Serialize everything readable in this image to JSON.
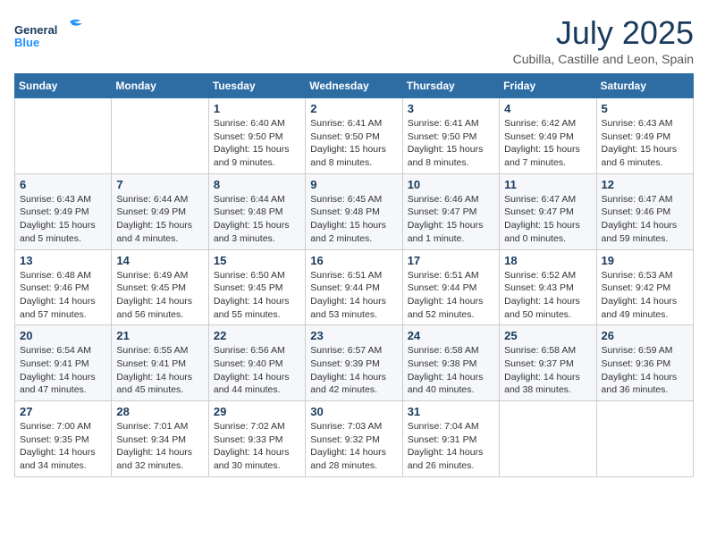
{
  "logo": {
    "line1": "General",
    "line2": "Blue"
  },
  "title": "July 2025",
  "location": "Cubilla, Castille and Leon, Spain",
  "weekdays": [
    "Sunday",
    "Monday",
    "Tuesday",
    "Wednesday",
    "Thursday",
    "Friday",
    "Saturday"
  ],
  "weeks": [
    [
      {
        "day": "",
        "info": ""
      },
      {
        "day": "",
        "info": ""
      },
      {
        "day": "1",
        "info": "Sunrise: 6:40 AM\nSunset: 9:50 PM\nDaylight: 15 hours and 9 minutes."
      },
      {
        "day": "2",
        "info": "Sunrise: 6:41 AM\nSunset: 9:50 PM\nDaylight: 15 hours and 8 minutes."
      },
      {
        "day": "3",
        "info": "Sunrise: 6:41 AM\nSunset: 9:50 PM\nDaylight: 15 hours and 8 minutes."
      },
      {
        "day": "4",
        "info": "Sunrise: 6:42 AM\nSunset: 9:49 PM\nDaylight: 15 hours and 7 minutes."
      },
      {
        "day": "5",
        "info": "Sunrise: 6:43 AM\nSunset: 9:49 PM\nDaylight: 15 hours and 6 minutes."
      }
    ],
    [
      {
        "day": "6",
        "info": "Sunrise: 6:43 AM\nSunset: 9:49 PM\nDaylight: 15 hours and 5 minutes."
      },
      {
        "day": "7",
        "info": "Sunrise: 6:44 AM\nSunset: 9:49 PM\nDaylight: 15 hours and 4 minutes."
      },
      {
        "day": "8",
        "info": "Sunrise: 6:44 AM\nSunset: 9:48 PM\nDaylight: 15 hours and 3 minutes."
      },
      {
        "day": "9",
        "info": "Sunrise: 6:45 AM\nSunset: 9:48 PM\nDaylight: 15 hours and 2 minutes."
      },
      {
        "day": "10",
        "info": "Sunrise: 6:46 AM\nSunset: 9:47 PM\nDaylight: 15 hours and 1 minute."
      },
      {
        "day": "11",
        "info": "Sunrise: 6:47 AM\nSunset: 9:47 PM\nDaylight: 15 hours and 0 minutes."
      },
      {
        "day": "12",
        "info": "Sunrise: 6:47 AM\nSunset: 9:46 PM\nDaylight: 14 hours and 59 minutes."
      }
    ],
    [
      {
        "day": "13",
        "info": "Sunrise: 6:48 AM\nSunset: 9:46 PM\nDaylight: 14 hours and 57 minutes."
      },
      {
        "day": "14",
        "info": "Sunrise: 6:49 AM\nSunset: 9:45 PM\nDaylight: 14 hours and 56 minutes."
      },
      {
        "day": "15",
        "info": "Sunrise: 6:50 AM\nSunset: 9:45 PM\nDaylight: 14 hours and 55 minutes."
      },
      {
        "day": "16",
        "info": "Sunrise: 6:51 AM\nSunset: 9:44 PM\nDaylight: 14 hours and 53 minutes."
      },
      {
        "day": "17",
        "info": "Sunrise: 6:51 AM\nSunset: 9:44 PM\nDaylight: 14 hours and 52 minutes."
      },
      {
        "day": "18",
        "info": "Sunrise: 6:52 AM\nSunset: 9:43 PM\nDaylight: 14 hours and 50 minutes."
      },
      {
        "day": "19",
        "info": "Sunrise: 6:53 AM\nSunset: 9:42 PM\nDaylight: 14 hours and 49 minutes."
      }
    ],
    [
      {
        "day": "20",
        "info": "Sunrise: 6:54 AM\nSunset: 9:41 PM\nDaylight: 14 hours and 47 minutes."
      },
      {
        "day": "21",
        "info": "Sunrise: 6:55 AM\nSunset: 9:41 PM\nDaylight: 14 hours and 45 minutes."
      },
      {
        "day": "22",
        "info": "Sunrise: 6:56 AM\nSunset: 9:40 PM\nDaylight: 14 hours and 44 minutes."
      },
      {
        "day": "23",
        "info": "Sunrise: 6:57 AM\nSunset: 9:39 PM\nDaylight: 14 hours and 42 minutes."
      },
      {
        "day": "24",
        "info": "Sunrise: 6:58 AM\nSunset: 9:38 PM\nDaylight: 14 hours and 40 minutes."
      },
      {
        "day": "25",
        "info": "Sunrise: 6:58 AM\nSunset: 9:37 PM\nDaylight: 14 hours and 38 minutes."
      },
      {
        "day": "26",
        "info": "Sunrise: 6:59 AM\nSunset: 9:36 PM\nDaylight: 14 hours and 36 minutes."
      }
    ],
    [
      {
        "day": "27",
        "info": "Sunrise: 7:00 AM\nSunset: 9:35 PM\nDaylight: 14 hours and 34 minutes."
      },
      {
        "day": "28",
        "info": "Sunrise: 7:01 AM\nSunset: 9:34 PM\nDaylight: 14 hours and 32 minutes."
      },
      {
        "day": "29",
        "info": "Sunrise: 7:02 AM\nSunset: 9:33 PM\nDaylight: 14 hours and 30 minutes."
      },
      {
        "day": "30",
        "info": "Sunrise: 7:03 AM\nSunset: 9:32 PM\nDaylight: 14 hours and 28 minutes."
      },
      {
        "day": "31",
        "info": "Sunrise: 7:04 AM\nSunset: 9:31 PM\nDaylight: 14 hours and 26 minutes."
      },
      {
        "day": "",
        "info": ""
      },
      {
        "day": "",
        "info": ""
      }
    ]
  ]
}
